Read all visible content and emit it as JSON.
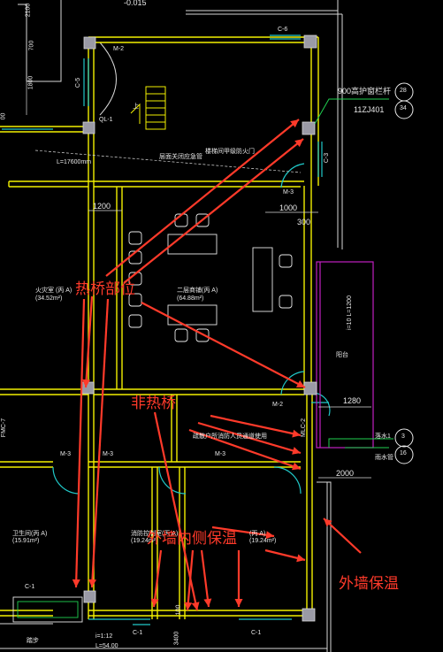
{
  "colors": {
    "background": "#000000",
    "wall": "#f2f000",
    "column": "#9a9aa6",
    "insulation": "#d0d0d0",
    "door": "#20c8c8",
    "annotation_red": "#ff3a2a",
    "balcony": "#c020c0",
    "leader_green": "#20d050"
  },
  "annotations": {
    "thermal_bridge": "热桥部位",
    "non_thermal_bridge": "非热桥",
    "inner_insulation": "外墙内侧保温",
    "outer_insulation": "外墙保温"
  },
  "cad_text": {
    "top_elev": "-0.015",
    "c6": "C-6",
    "c5": "C-5",
    "m2_top": "M-2",
    "rail": "900高护窗栏杆",
    "std": "11ZJ401",
    "det_top": "28",
    "det_bot": "34",
    "up": "上",
    "ql": "QL-1",
    "fire_door": "楼梯间甲级防火门",
    "fire_note": "层面关闭应急管",
    "dist": "L=17600mm",
    "c3": "C-3",
    "m3_right": "M-3",
    "d1000": "1000",
    "d300": "300",
    "d1200": "1200",
    "room_left": "火灾室 (丙 A)",
    "room_left_area": "(34.52m²)",
    "room_center": "二层商铺(丙 A)",
    "room_center_area": "(64.88m²)",
    "balcony_label": "阳台",
    "slope": "i=10 L=1200",
    "d1280": "1280",
    "m2_lower": "M-2",
    "mlc": "MLC-2",
    "refuge_note": "疏散户所消防人员通道使用",
    "fmc": "FMC-7",
    "m3_a": "M-3",
    "m3_b": "M-3",
    "m3_c": "M-3",
    "drain": "落水1",
    "pipe": "雨水管",
    "det2_top": "3",
    "det2_bot": "16",
    "d2000": "2000",
    "room_bl": "卫生间(丙 A)",
    "room_bl_area": "(15.91m²)",
    "room_bm": "消防控制室(丙 A)",
    "room_bm_area": "(19.24m²)",
    "room_br": "(丙 A)",
    "room_br_area": "(19.24m²)",
    "c1_left": "C-1",
    "c1_mid": "C-1",
    "c1_right": "C-1",
    "ramp": "i=1:12",
    "ramp_len": "L=54.00",
    "d100": "100",
    "d3400": "3400",
    "dim_700": "700",
    "dim_1800": "1800",
    "dim_2100": "2100",
    "dim_00": "00",
    "legend_lbl": "踏步"
  }
}
